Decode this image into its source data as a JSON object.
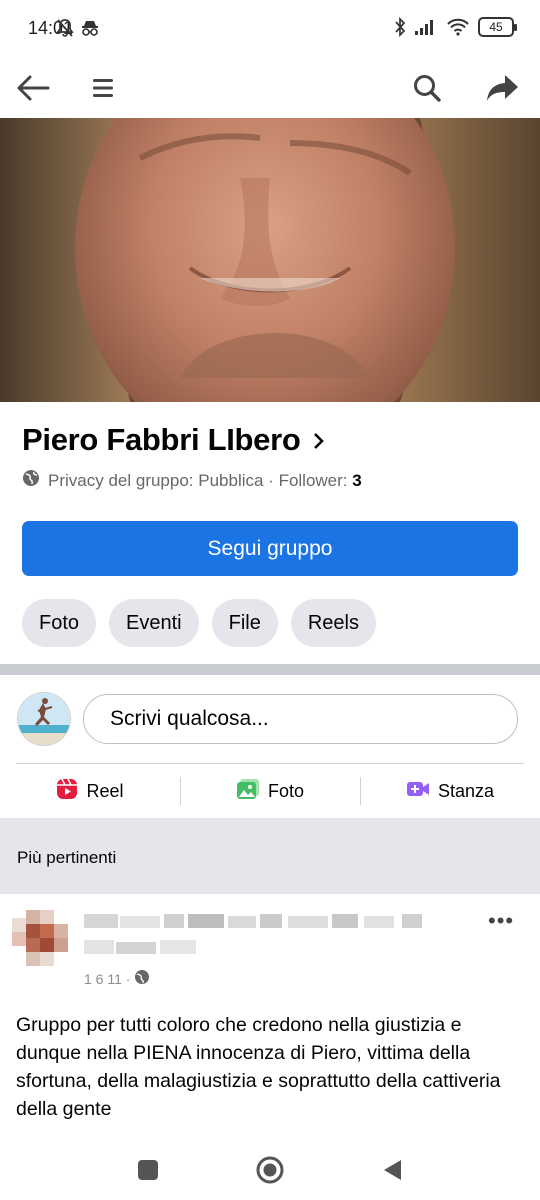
{
  "status_bar": {
    "time": "14:01",
    "battery": "45",
    "icons": [
      "mute-icon",
      "incognito-icon",
      "bluetooth-icon",
      "signal-icon",
      "wifi-icon",
      "battery-icon"
    ]
  },
  "app_bar": {
    "icons": [
      "back-arrow-icon",
      "menu-icon",
      "search-icon",
      "share-icon"
    ]
  },
  "group": {
    "name": "Piero Fabbri LIbero",
    "privacy_text": "Privacy del gruppo: Pubblica · Follower: ",
    "follower_count": "3",
    "follow_button": "Segui gruppo",
    "tabs": [
      "Foto",
      "Eventi",
      "File",
      "Reels"
    ]
  },
  "composer": {
    "placeholder": "Scrivi qualcosa...",
    "actions": [
      {
        "label": "Reel",
        "icon": "reel-icon",
        "color": "#e41e3f"
      },
      {
        "label": "Foto",
        "icon": "photo-icon",
        "color": "#45bd62"
      },
      {
        "label": "Stanza",
        "icon": "room-video-icon",
        "color": "#9360f7"
      }
    ]
  },
  "feed": {
    "section_title": "Più pertinenti",
    "post": {
      "meta": "1 6 11 ·",
      "more": "•••",
      "body": "Gruppo per tutti coloro che credono nella giustizia e dunque nella PIENA innocenza di Piero, vittima della sfortuna, della malagiustizia e soprattutto della cattiveria della gente"
    }
  },
  "colors": {
    "primary": "#1b74e4",
    "chip_bg": "#e4e6eb",
    "secondary_text": "#65676b"
  }
}
